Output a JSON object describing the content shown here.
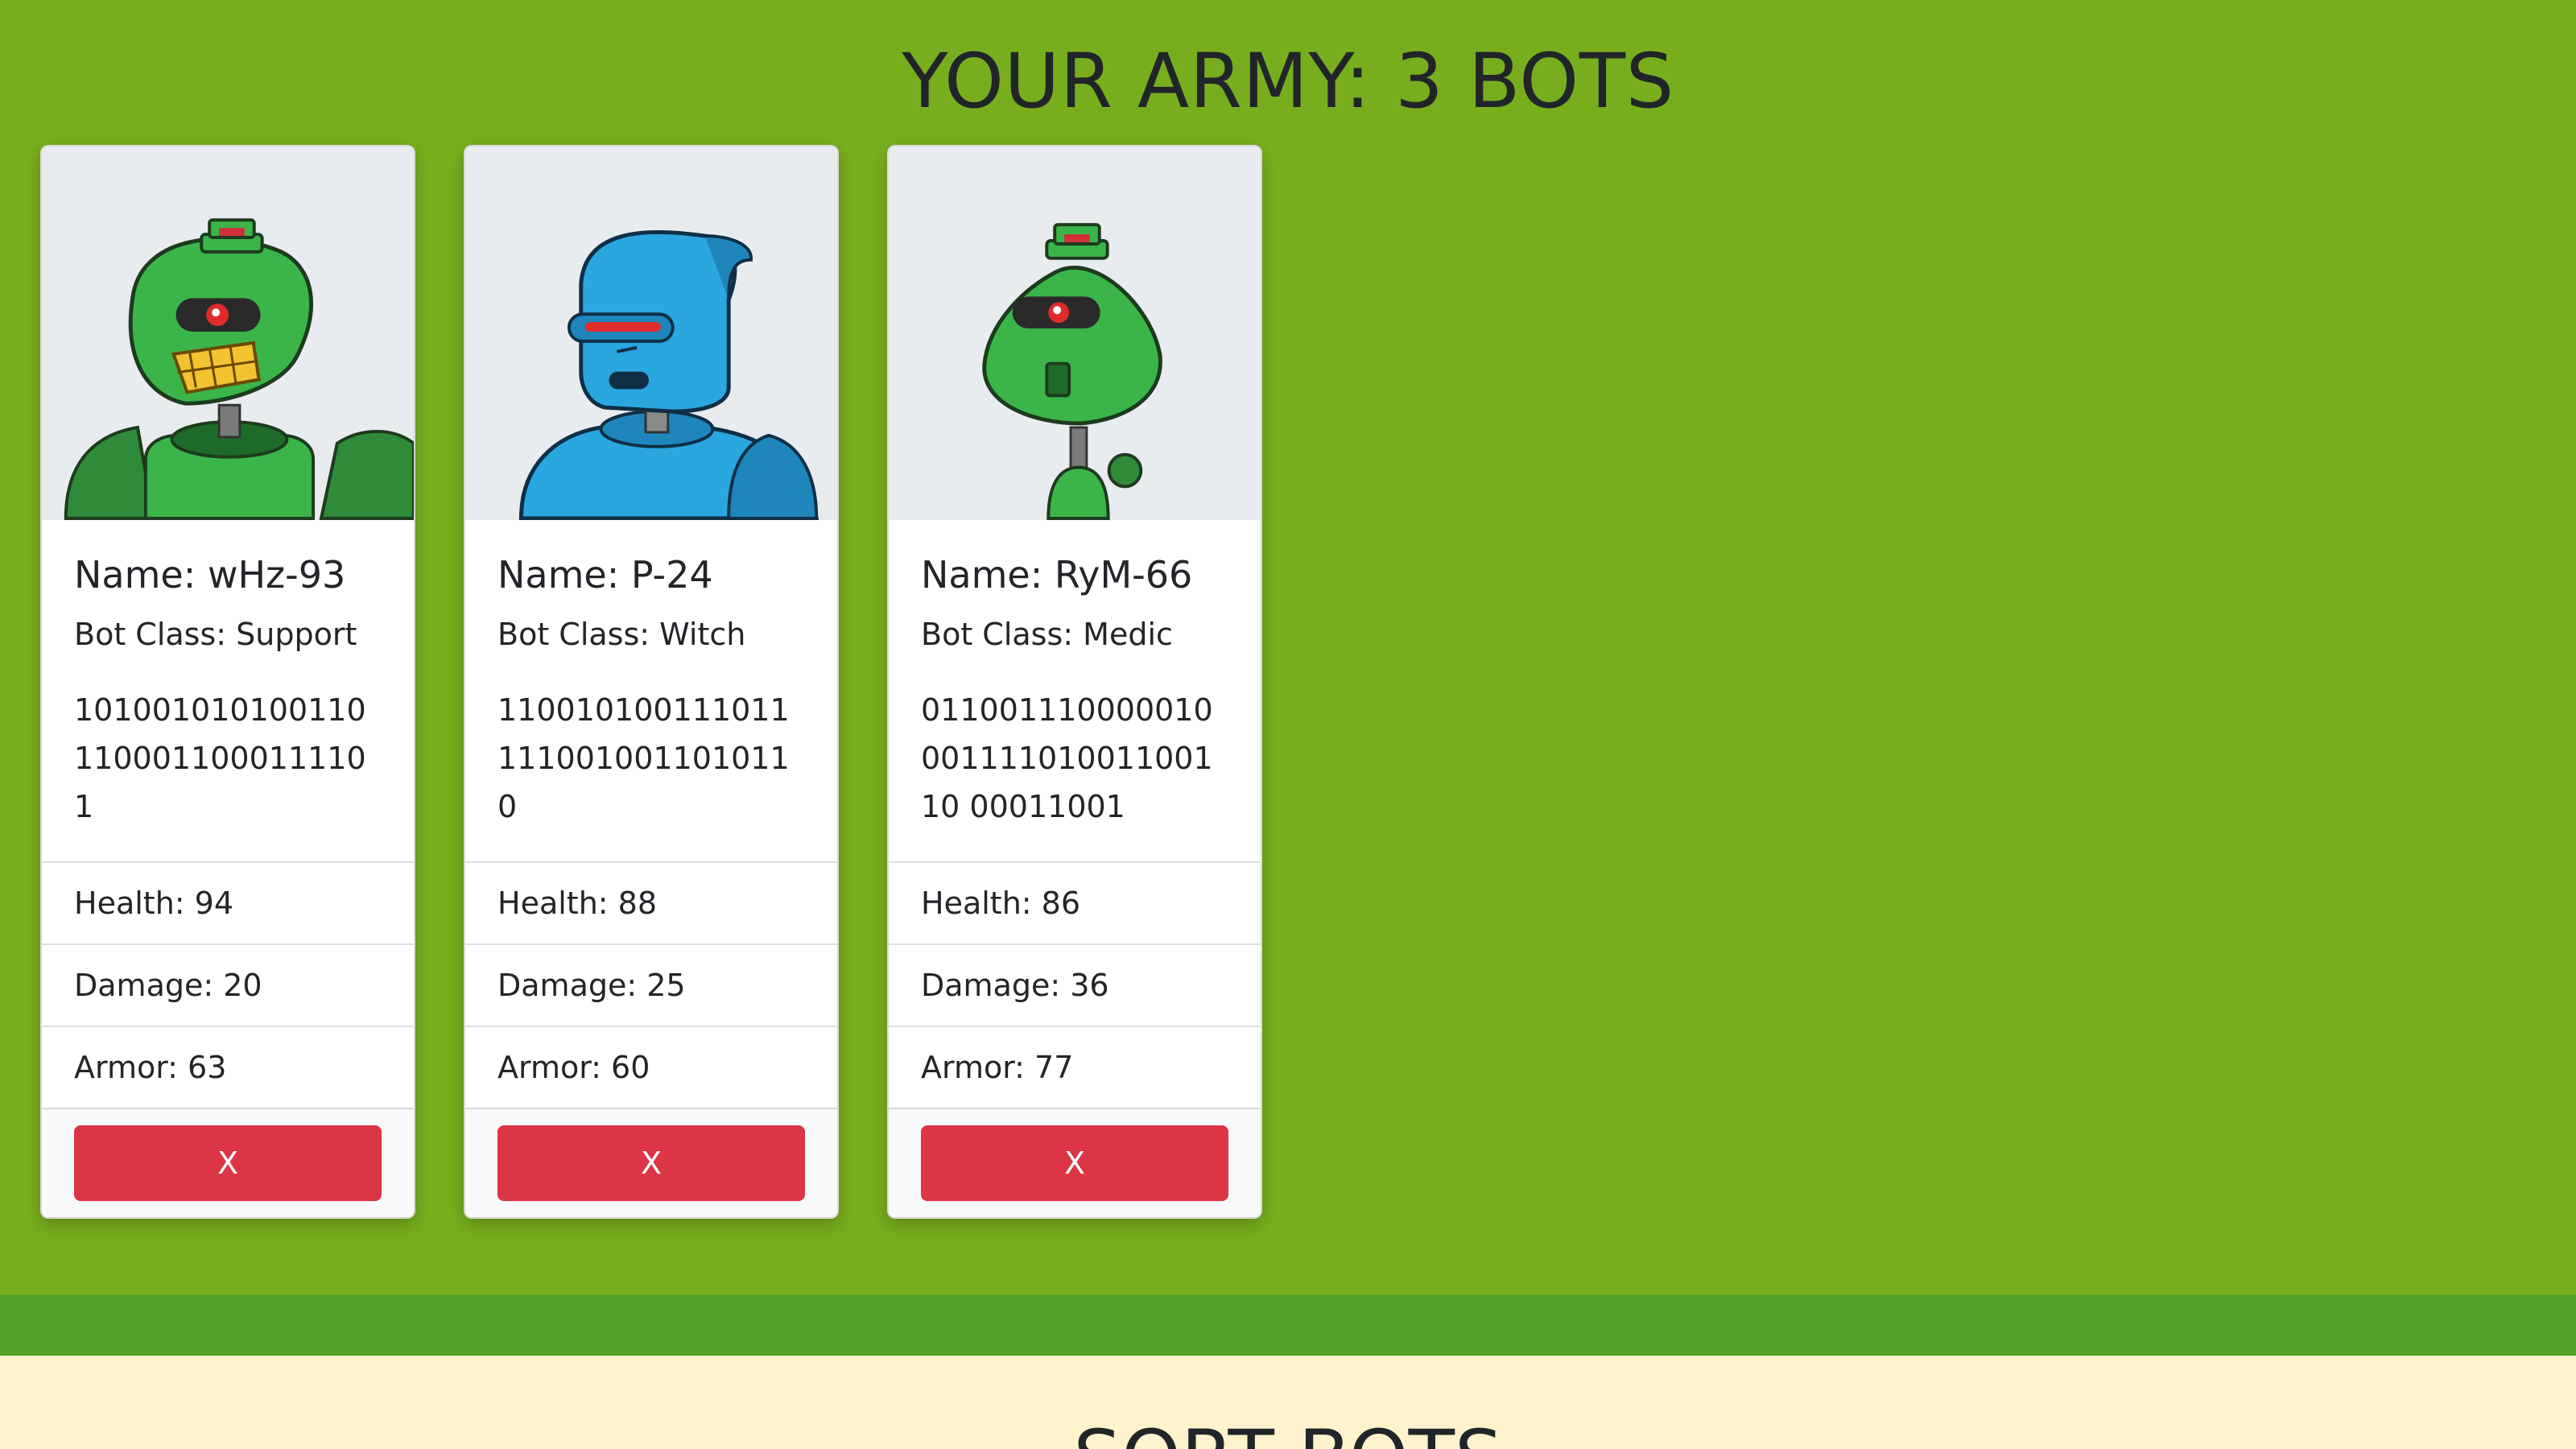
{
  "army": {
    "title": "YOUR ARMY: 3 BOTS",
    "bots": [
      {
        "name": "Name: wHz-93",
        "bot_class": "Bot Class: Support",
        "catchphrase": "1010010101001101100011000111101",
        "health": "Health: 94",
        "damage": "Damage: 20",
        "armor": "Armor: 63",
        "remove_label": "X",
        "avatar_icon": "green-robot-grin-icon"
      },
      {
        "name": "Name: P-24",
        "bot_class": "Bot Class: Witch",
        "catchphrase": "1100101001110111110010011010110",
        "health": "Health: 88",
        "damage": "Damage: 25",
        "armor": "Armor: 60",
        "remove_label": "X",
        "avatar_icon": "blue-robot-icon"
      },
      {
        "name": "Name: RyM-66",
        "bot_class": "Bot Class: Medic",
        "catchphrase": "01100111000001000111101001100110 00011001",
        "health": "Health: 86",
        "damage": "Damage: 36",
        "armor": "Armor: 77",
        "remove_label": "X",
        "avatar_icon": "green-robot-antenna-icon"
      }
    ]
  },
  "sort": {
    "title": "SORT BOTS"
  },
  "colors": {
    "army_bg": "#78ae1e",
    "band": "#53a127",
    "sort_bg": "#fff3cd",
    "danger": "#dc3545"
  }
}
